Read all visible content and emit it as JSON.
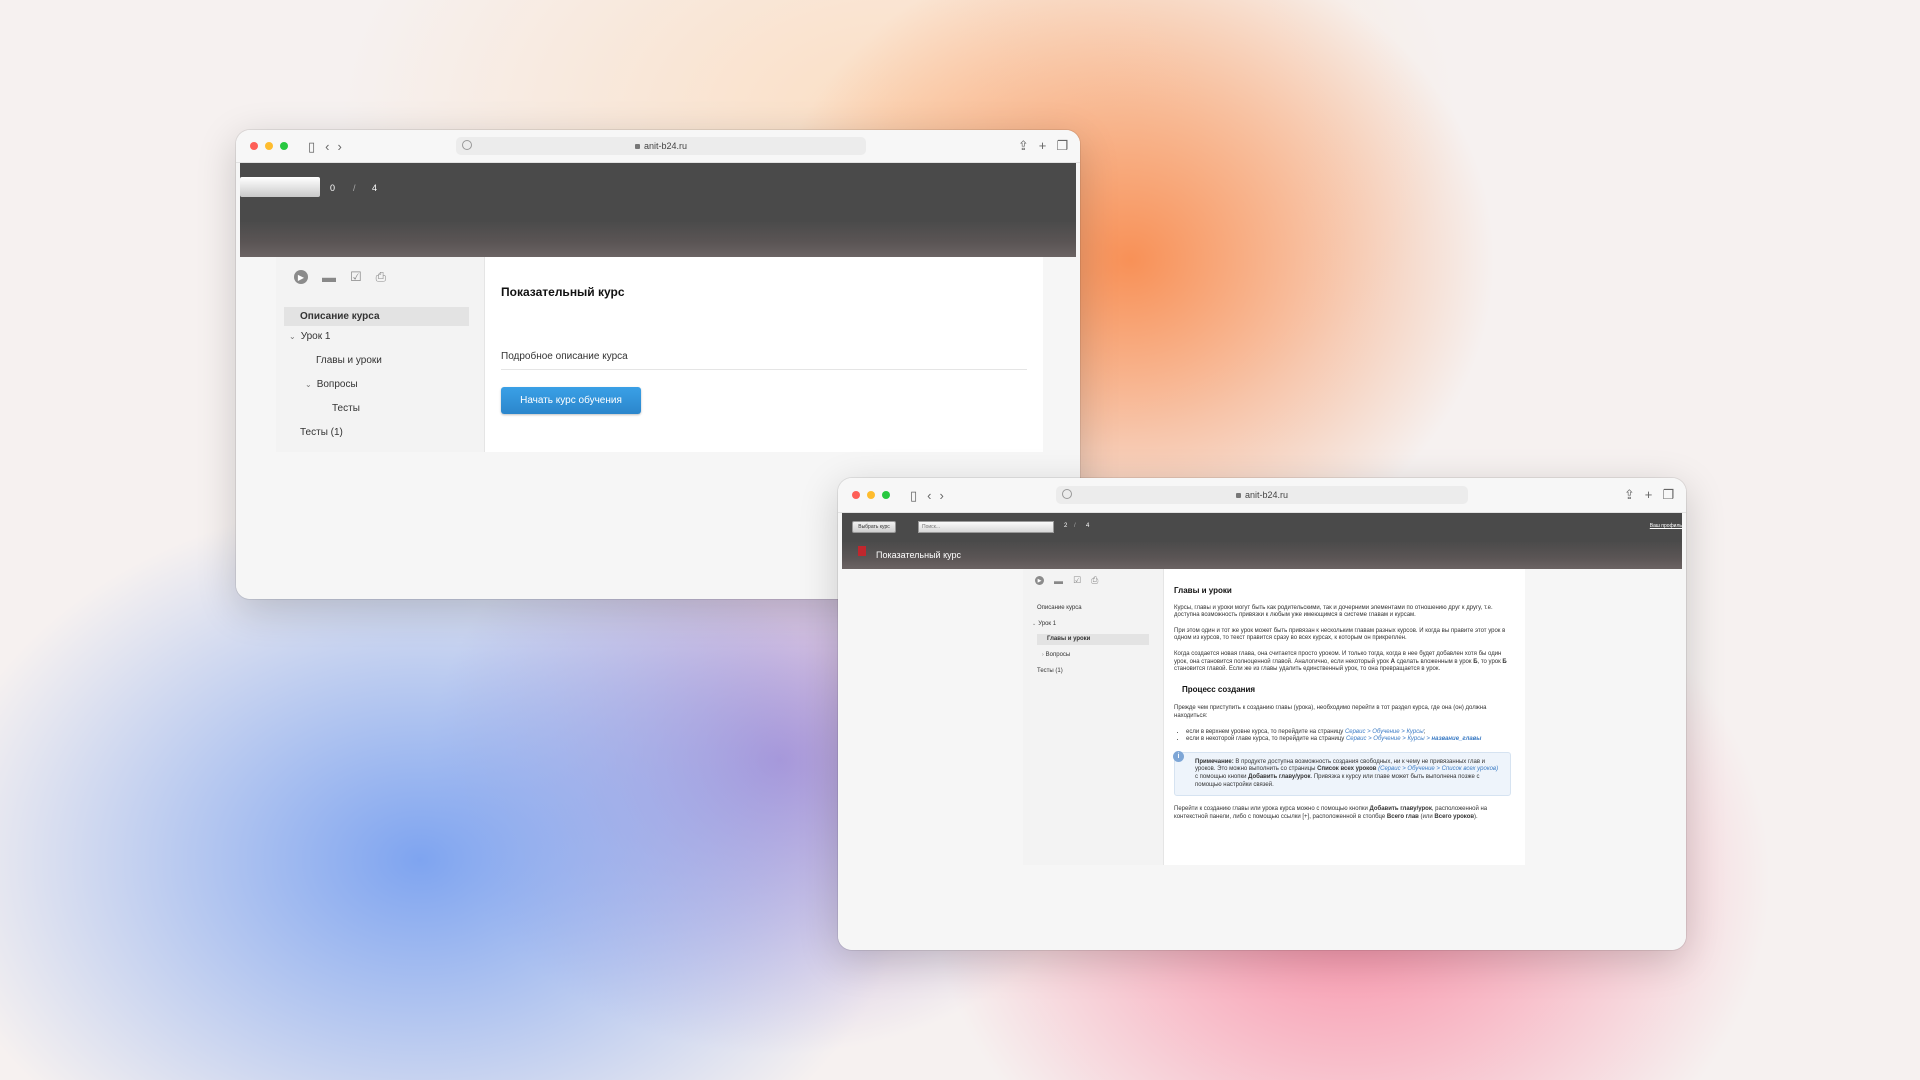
{
  "window1": {
    "url": "anit-b24.ru",
    "header": {
      "current": "0",
      "separator": "/",
      "total": "4"
    },
    "tree": [
      {
        "label": "Описание курса"
      },
      {
        "label": "Урок 1"
      },
      {
        "label": "Главы и уроки"
      },
      {
        "label": "Вопросы"
      },
      {
        "label": "Тесты"
      },
      {
        "label": "Тесты (1)"
      }
    ],
    "course_title": "Показательный курс",
    "course_description": "Подробное описание курса",
    "start_button": "Начать курс обучения"
  },
  "window2": {
    "url": "anit-b24.ru",
    "header": {
      "select_course_button": "Выбрать курс",
      "search_placeholder": "Поиск...",
      "current": "2",
      "separator": "/",
      "total": "4",
      "profile_link": "Ваш профиль"
    },
    "course_name": "Показательный курс",
    "tree": [
      {
        "label": "Описание курса"
      },
      {
        "label": "Урок 1"
      },
      {
        "label": "Главы и уроки"
      },
      {
        "label": "Вопросы"
      },
      {
        "label": "Тесты (1)"
      }
    ],
    "article": {
      "title": "Главы и уроки",
      "p1": "Курсы, главы и уроки могут быть как родительскими, так и дочерними элементами по отношению друг к другу, т.е. доступна возможность привязки к любым уже имеющимся в системе главам и курсам.",
      "p2": "При этом один и тот же урок может быть привязан к нескольким главам разных курсов. И когда вы правите этот урок в одном из курсов, то текст правится сразу во всех курсах, к которым он прикреплен.",
      "p3_a": "Когда создается новая глава, она считается просто уроком. И только тогда, когда в нее будет добавлен хотя бы один урок, она становится полноценной главой. Аналогично, если некоторый урок ",
      "p3_a_bold": "А",
      "p3_b": " сделать вложенным в урок ",
      "p3_b_bold": "Б",
      "p3_c": ", то урок ",
      "p3_c_bold": "Б",
      "p3_d": " становится главой. Если же из главы удалить единственный урок, то она превращается в урок.",
      "subtitle": "Процесс создания",
      "p4": "Прежде чем приступить к созданию главы (урока), необходимо перейти в тот раздел курса, где она (он) должна находиться:",
      "li1_text": "если в верхнем уровне курса, то перейдите на страницу ",
      "li1_link": "Сервис > Обучение > Курсы",
      "li1_end": ";",
      "li2_text": "если в некоторой главе курса, то перейдите на страницу ",
      "li2_link": "Сервис > Обучение > Курсы > ",
      "li2_link_bold": "название_главы",
      "note_label": "Примечание:",
      "note_a": " В продукте доступна возможность создания свободных, ни к чему не привязанных глав и уроков. Это можно выполнить со страницы ",
      "note_bold1": "Список всех уроков",
      "note_link": " (Сервис > Обучение > Список всех уроков)",
      "note_b": " с помощью кнопки ",
      "note_bold2": "Добавить главу/урок",
      "note_c": ". Привязка к курсу или главе может быть выполнена позже с помощью настройки связей.",
      "p5_a": "Перейти к созданию главы или урока курса можно с помощью кнопки ",
      "p5_bold1": "Добавить главу/урок",
      "p5_b": ", расположенной на контекстной панели, либо с помощью ссылки [+], расположенной в столбце ",
      "p5_bold2": "Всего глав",
      "p5_c": " (или ",
      "p5_bold3": "Всего уроков",
      "p5_d": ")."
    }
  },
  "colors": {
    "header_bg": "#4a4a4a",
    "accent_button": "#2b86cc",
    "link": "#3b7bc4",
    "note_bg": "#eef4fb"
  }
}
